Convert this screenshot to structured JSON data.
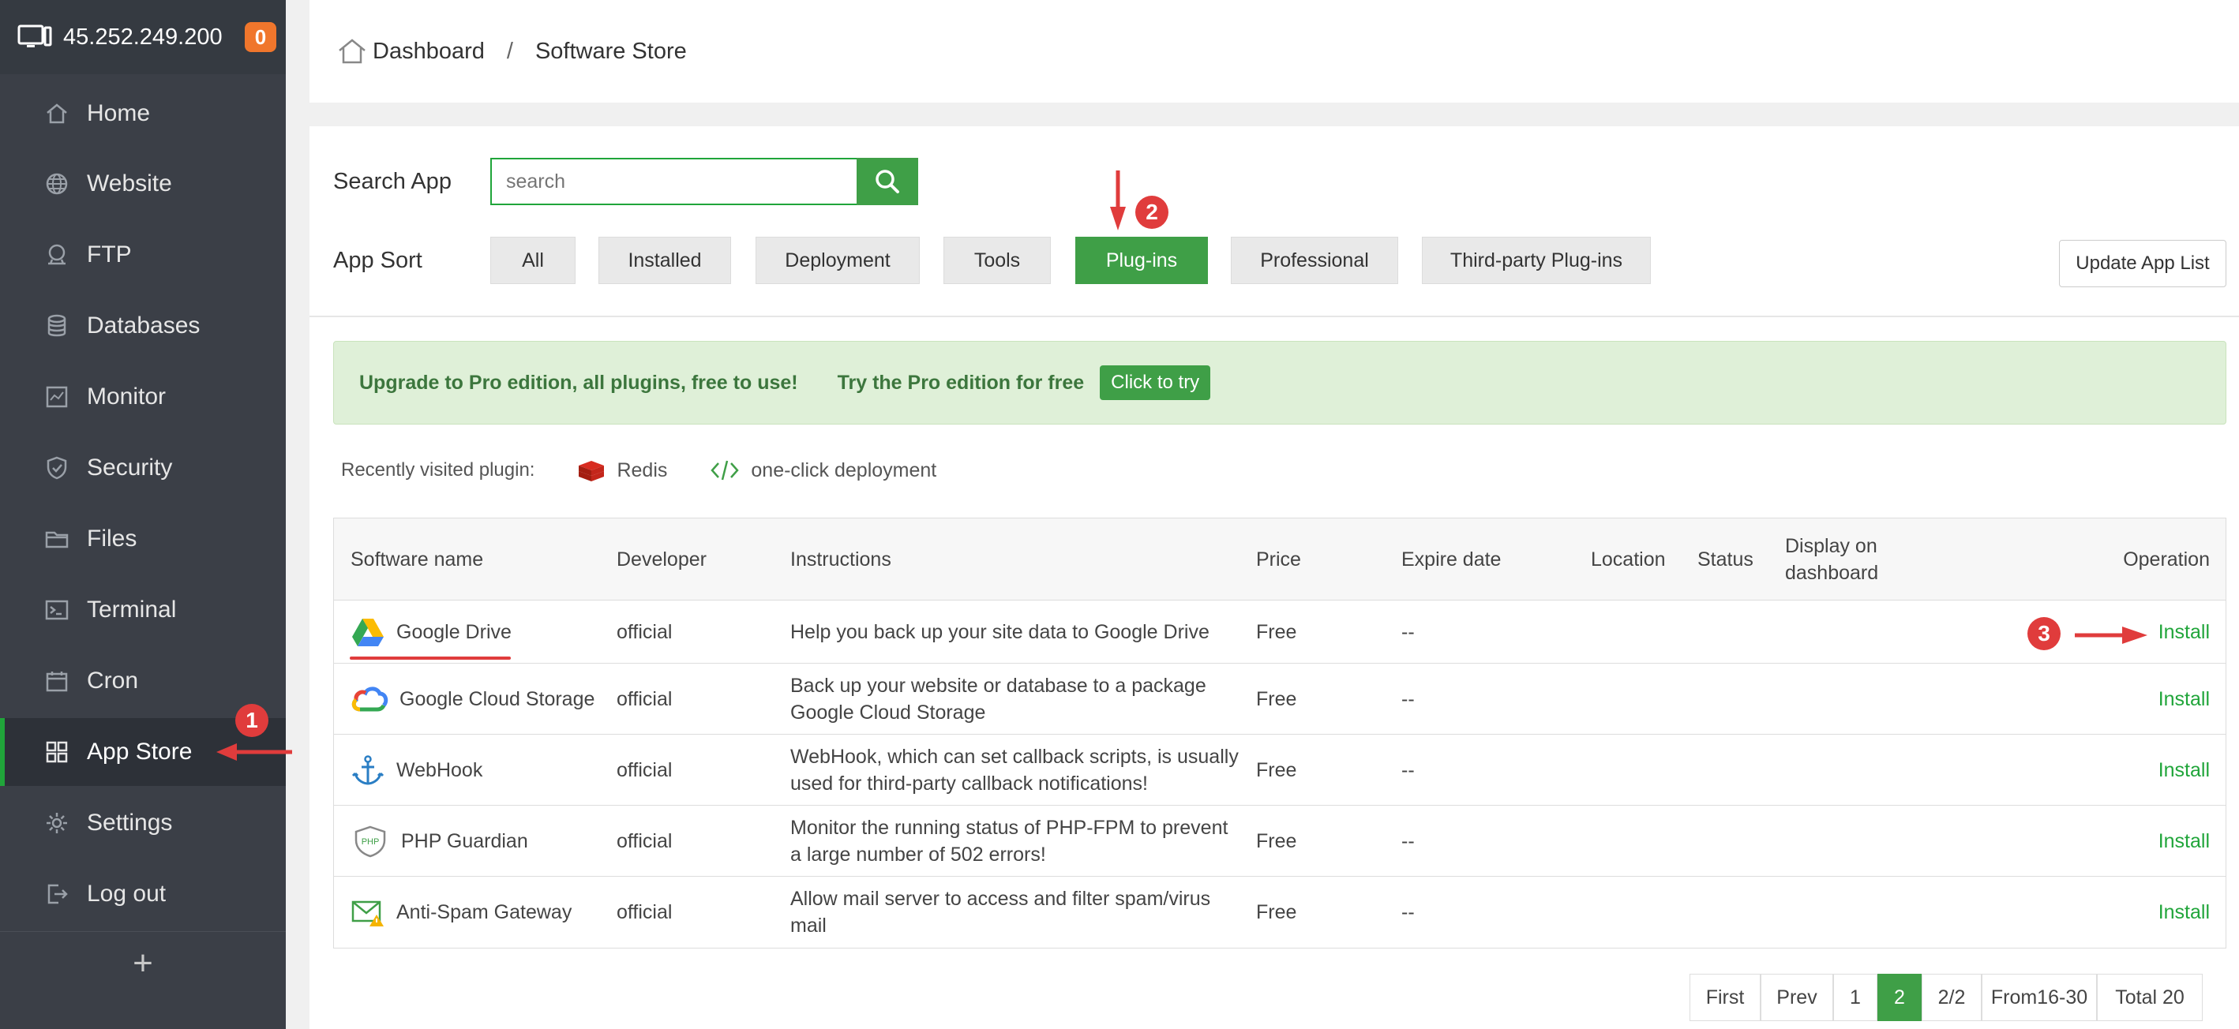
{
  "sidebar": {
    "ip": "45.252.249.200",
    "badge": "0",
    "items": [
      {
        "label": "Home",
        "icon": "home-icon"
      },
      {
        "label": "Website",
        "icon": "globe-icon"
      },
      {
        "label": "FTP",
        "icon": "ftp-icon"
      },
      {
        "label": "Databases",
        "icon": "database-icon"
      },
      {
        "label": "Monitor",
        "icon": "monitor-icon"
      },
      {
        "label": "Security",
        "icon": "shield-icon"
      },
      {
        "label": "Files",
        "icon": "folder-icon"
      },
      {
        "label": "Terminal",
        "icon": "terminal-icon"
      },
      {
        "label": "Cron",
        "icon": "calendar-icon"
      },
      {
        "label": "App Store",
        "icon": "grid-icon",
        "active": true
      },
      {
        "label": "Settings",
        "icon": "gear-icon"
      },
      {
        "label": "Log out",
        "icon": "logout-icon"
      }
    ],
    "add": "+"
  },
  "breadcrumb": {
    "home": "Dashboard",
    "separator": "/",
    "current": "Software Store"
  },
  "search": {
    "label": "Search App",
    "placeholder": "search"
  },
  "sort": {
    "label": "App Sort",
    "buttons": [
      "All",
      "Installed",
      "Deployment",
      "Tools",
      "Plug-ins",
      "Professional",
      "Third-party Plug-ins"
    ],
    "active": "Plug-ins"
  },
  "update_button": "Update App List",
  "promo": {
    "text": "Upgrade to Pro edition, all plugins, free to use!",
    "try_text": "Try the Pro edition for free",
    "try_button": "Click to try"
  },
  "recent": {
    "label": "Recently visited plugin:",
    "items": [
      "Redis",
      "one-click deployment"
    ]
  },
  "table": {
    "headers": {
      "name": "Software name",
      "developer": "Developer",
      "instructions": "Instructions",
      "price": "Price",
      "expire": "Expire date",
      "location": "Location",
      "status": "Status",
      "display_line1": "Display on",
      "display_line2": "dashboard",
      "operation": "Operation"
    },
    "rows": [
      {
        "name": "Google Drive",
        "developer": "official",
        "instr1": "Help you back up your site data to Google Drive",
        "instr2": "",
        "price": "Free",
        "expire": "--",
        "op": "Install"
      },
      {
        "name": "Google Cloud Storage",
        "developer": "official",
        "instr1": "Back up your website or database to a package",
        "instr2": "Google Cloud Storage",
        "price": "Free",
        "expire": "--",
        "op": "Install"
      },
      {
        "name": "WebHook",
        "developer": "official",
        "instr1": "WebHook, which can set callback scripts, is usually",
        "instr2": "used for third-party callback notifications!",
        "price": "Free",
        "expire": "--",
        "op": "Install"
      },
      {
        "name": "PHP Guardian",
        "developer": "official",
        "instr1": "Monitor the running status of PHP-FPM to prevent",
        "instr2": "a large number of 502 errors!",
        "price": "Free",
        "expire": "--",
        "op": "Install"
      },
      {
        "name": "Anti-Spam Gateway",
        "developer": "official",
        "instr1": "Allow mail server to access and filter spam/virus",
        "instr2": "mail",
        "price": "Free",
        "expire": "--",
        "op": "Install"
      }
    ]
  },
  "pagination": {
    "first": "First",
    "prev": "Prev",
    "p1": "1",
    "p2": "2",
    "pages": "2/2",
    "range": "From16-30",
    "total": "Total 20"
  },
  "annotations": {
    "a1": "1",
    "a2": "2",
    "a3": "3"
  },
  "colors": {
    "sidebar_bg": "#3b3f47",
    "accent": "#20a53a",
    "button_green": "#3f9f47",
    "badge": "#f0762c",
    "annotation_red": "#e03c3c"
  }
}
